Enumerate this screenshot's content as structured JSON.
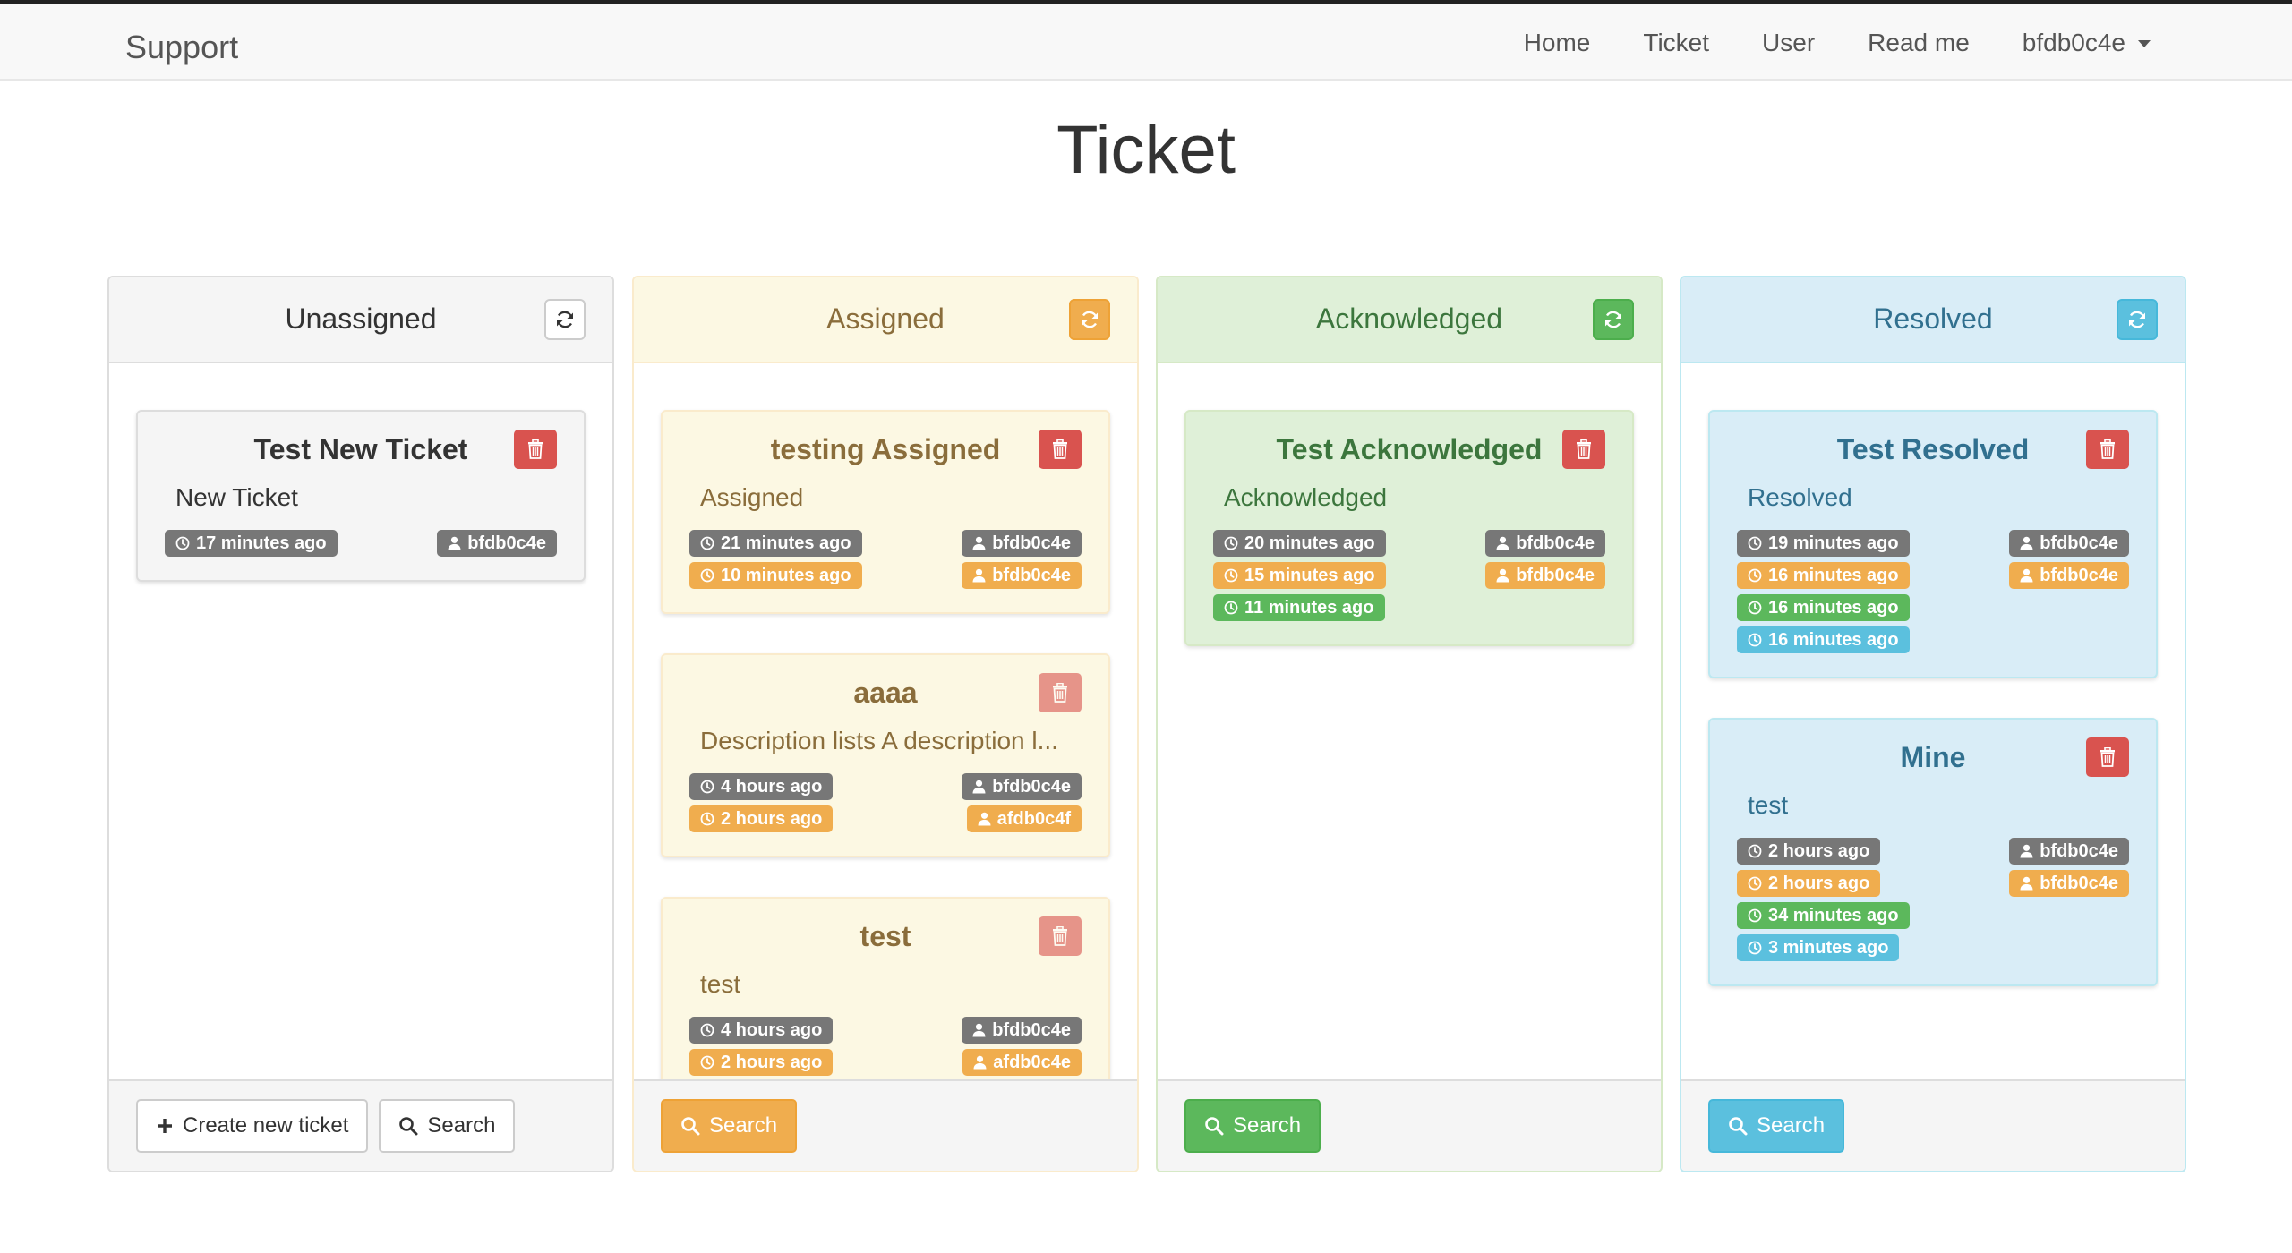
{
  "nav": {
    "brand": "Support",
    "links": [
      "Home",
      "Ticket",
      "User",
      "Read me"
    ],
    "user": "bfdb0c4e"
  },
  "page": {
    "title": "Ticket"
  },
  "columns": [
    {
      "title": "Unassigned",
      "cards": [
        {
          "title": "Test New Ticket",
          "desc": "New Ticket",
          "times": [
            "17 minutes ago"
          ],
          "users": [
            "bfdb0c4e"
          ]
        }
      ],
      "footer": {
        "create": "Create new ticket",
        "search": "Search"
      }
    },
    {
      "title": "Assigned",
      "cards": [
        {
          "title": "testing Assigned",
          "desc": "Assigned",
          "times": [
            "21 minutes ago",
            "10 minutes ago"
          ],
          "users": [
            "bfdb0c4e",
            "bfdb0c4e"
          ]
        },
        {
          "title": "aaaa",
          "desc": "Description lists A description l...",
          "times": [
            "4 hours ago",
            "2 hours ago"
          ],
          "users": [
            "bfdb0c4e",
            "afdb0c4f"
          ]
        },
        {
          "title": "test",
          "desc": "test",
          "times": [
            "4 hours ago",
            "2 hours ago"
          ],
          "users": [
            "bfdb0c4e",
            "afdb0c4e"
          ]
        }
      ],
      "footer": {
        "search": "Search"
      }
    },
    {
      "title": "Acknowledged",
      "cards": [
        {
          "title": "Test Acknowledged",
          "desc": "Acknowledged",
          "times": [
            "20 minutes ago",
            "15 minutes ago",
            "11 minutes ago"
          ],
          "users": [
            "bfdb0c4e",
            "bfdb0c4e"
          ]
        }
      ],
      "footer": {
        "search": "Search"
      }
    },
    {
      "title": "Resolved",
      "cards": [
        {
          "title": "Test Resolved",
          "desc": "Resolved",
          "times": [
            "19 minutes ago",
            "16 minutes ago",
            "16 minutes ago",
            "16 minutes ago"
          ],
          "users": [
            "bfdb0c4e",
            "bfdb0c4e"
          ]
        },
        {
          "title": "Mine",
          "desc": "test",
          "times": [
            "2 hours ago",
            "2 hours ago",
            "34 minutes ago",
            "3 minutes ago"
          ],
          "users": [
            "bfdb0c4e",
            "bfdb0c4e"
          ]
        }
      ],
      "footer": {
        "search": "Search"
      }
    }
  ],
  "colors": {
    "unassigned": "#f5f5f5",
    "assigned": "#fcf8e3",
    "acknowledged": "#dff0d8",
    "resolved": "#d9edf7",
    "danger": "#d9534f",
    "warning": "#f0ad4e",
    "success": "#5cb85c",
    "info": "#5bc0de",
    "default": "#777777"
  }
}
